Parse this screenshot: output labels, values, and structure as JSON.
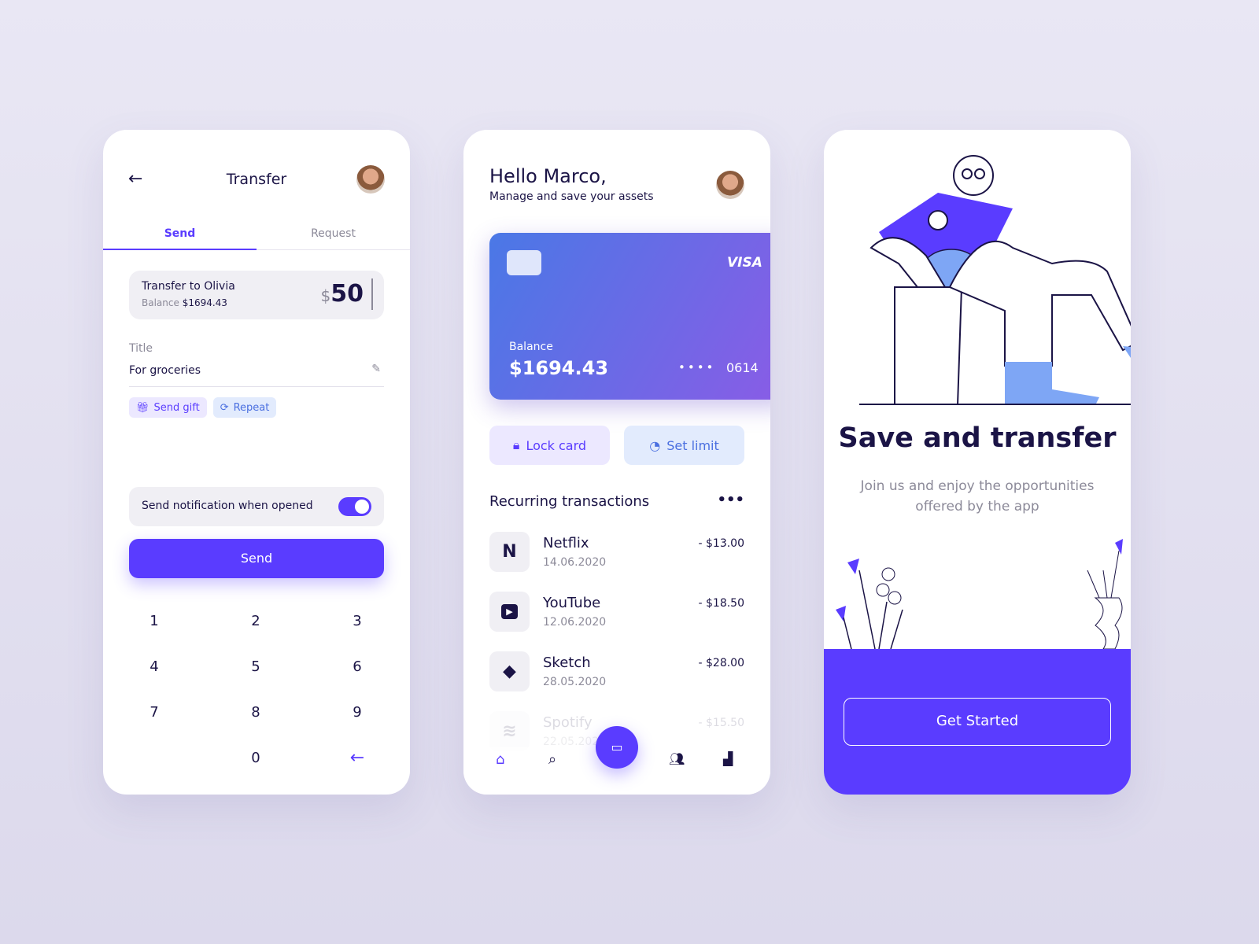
{
  "transfer": {
    "title": "Transfer",
    "tabs": [
      {
        "label": "Send"
      },
      {
        "label": "Request"
      }
    ],
    "recipient": "Transfer to Olivia",
    "balance_label": "Balance",
    "balance": "$1694.43",
    "currency": "$",
    "amount": "50",
    "title_label": "Title",
    "title_value": "For groceries",
    "chips": [
      {
        "label": "Send gift"
      },
      {
        "label": "Repeat"
      }
    ],
    "notification_label": "Send notification when opened",
    "notification_on": true,
    "send_label": "Send",
    "keys": [
      "1",
      "2",
      "3",
      "4",
      "5",
      "6",
      "7",
      "8",
      "9",
      "0"
    ]
  },
  "home": {
    "greeting": "Hello Marco,",
    "subtitle": "Manage and save your assets",
    "card": {
      "brand": "VISA",
      "balance_label": "Balance",
      "balance": "$1694.43",
      "masked": "••••",
      "last4": "0614"
    },
    "lock_label": "Lock card",
    "limit_label": "Set limit",
    "section_title": "Recurring transactions",
    "transactions": [
      {
        "name": "Netflix",
        "date": "14.06.2020",
        "amount": "- $13.00"
      },
      {
        "name": "YouTube",
        "date": "12.06.2020",
        "amount": "- $18.50"
      },
      {
        "name": "Sketch",
        "date": "28.05.2020",
        "amount": "- $28.00"
      },
      {
        "name": "Spotify",
        "date": "22.05.2020",
        "amount": "- $15.50"
      }
    ],
    "accent": "#5a3cff"
  },
  "onboarding": {
    "title": "Save and transfer",
    "subtitle": "Join us and enjoy the opportunities offered by the app",
    "cta": "Get Started"
  }
}
